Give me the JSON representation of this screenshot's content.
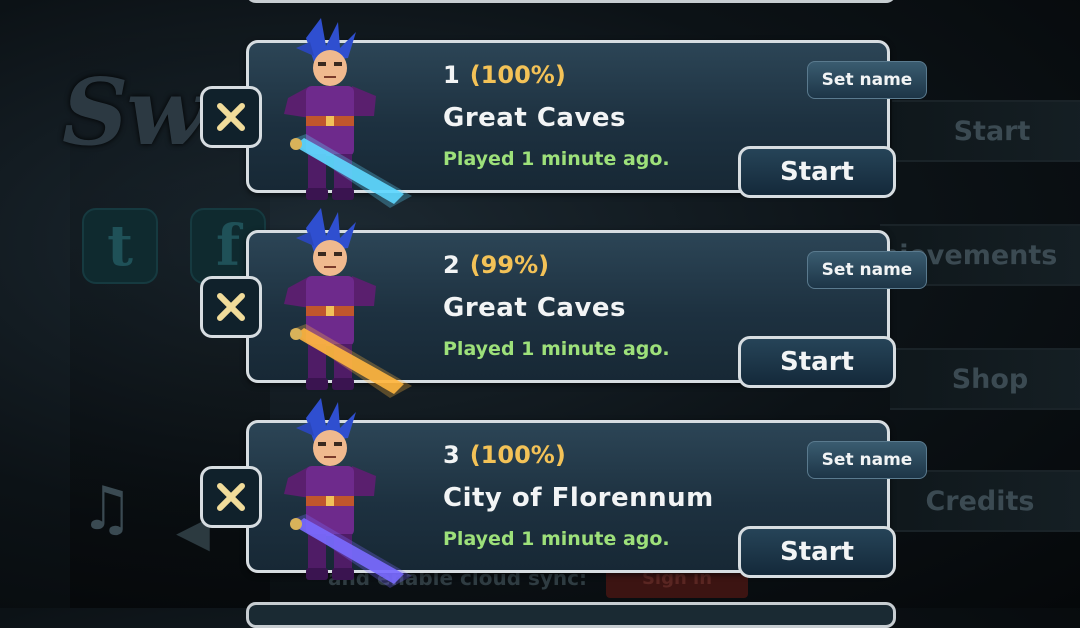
{
  "background": {
    "logo_text": "Swo",
    "twitter_letter": "t",
    "facebook_letter": "f",
    "menu": {
      "start": "Start",
      "achievements": "hievements",
      "shop": "Shop",
      "credits": "Credits"
    },
    "cloud_text": "and enable cloud sync:",
    "signin_label": "Sign in"
  },
  "slots": [
    {
      "number": "1",
      "percent": "(100%)",
      "location": "Great Caves",
      "played": "Played 1 minute ago.",
      "set_name_label": "Set name",
      "start_label": "Start",
      "weapon_color": "#5fd8ff"
    },
    {
      "number": "2",
      "percent": "(99%)",
      "location": "Great Caves",
      "played": "Played 1 minute ago.",
      "set_name_label": "Set name",
      "start_label": "Start",
      "weapon_color": "#ffb640"
    },
    {
      "number": "3",
      "percent": "(100%)",
      "location": "City of Florennum",
      "played": "Played 1 minute ago.",
      "set_name_label": "Set name",
      "start_label": "Start",
      "weapon_color": "#7a6bff"
    }
  ],
  "icons": {
    "delete": "close-icon",
    "music": "music-note-icon",
    "sound": "speaker-icon",
    "twitter": "twitter-icon",
    "facebook": "facebook-icon"
  },
  "colors": {
    "percent": "#f3c257",
    "played": "#9de07a",
    "delete_x": "#f1dc9a",
    "card_border": "#d7dde1"
  }
}
